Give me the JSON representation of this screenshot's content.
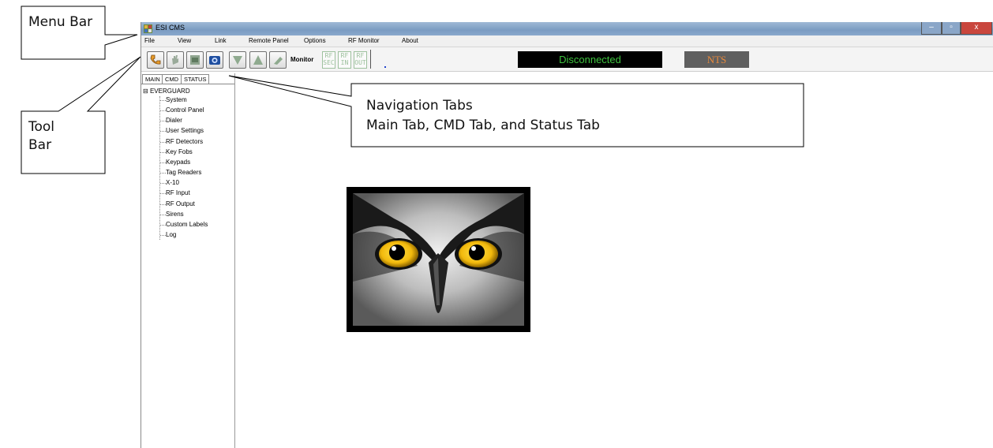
{
  "callouts": {
    "menu_bar": "Menu Bar",
    "tool_bar": "Tool Bar",
    "navigation_tabs_title": "Navigation Tabs",
    "navigation_tabs_desc": "Main Tab, CMD Tab, and Status Tab"
  },
  "window": {
    "title": "ESI CMS",
    "buttons": [
      "–",
      "▫",
      "x"
    ]
  },
  "menu": [
    "File",
    "View",
    "Link",
    "Remote Panel",
    "Options",
    "RF Monitor",
    "About"
  ],
  "toolbar": {
    "monitor_label": "Monitor",
    "rf_buttons": [
      {
        "top": "RF",
        "bottom": "SEC"
      },
      {
        "top": "RF",
        "bottom": "IN"
      },
      {
        "top": "RF",
        "bottom": "OUT"
      }
    ],
    "connection_status": "Disconnected",
    "nts_label": "NTS",
    "colors": {
      "status_text": "#3ec23e",
      "nts_text": "#e8893c"
    }
  },
  "nav_tabs": [
    "MAIN",
    "CMD",
    "STATUS"
  ],
  "tree": {
    "expander": "⊟",
    "root": "EVERGUARD",
    "items": [
      "System",
      "Control Panel",
      "Dialer",
      "User Settings",
      "RF Detectors",
      "Key Fobs",
      "Keypads",
      "Tag Readers",
      "X-10",
      "RF Input",
      "RF Output",
      "Sirens",
      "Custom Labels",
      "Log"
    ]
  },
  "logo": {
    "icon": "owl-logo"
  }
}
